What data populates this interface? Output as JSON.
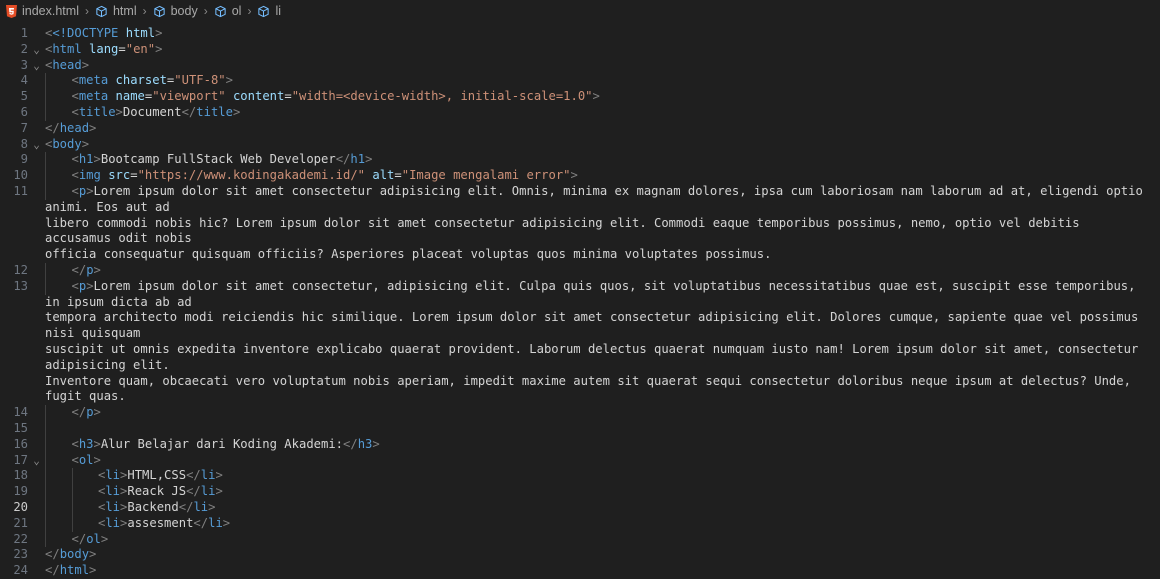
{
  "breadcrumb": {
    "file": "index.html",
    "items": [
      "html",
      "body",
      "ol",
      "li"
    ]
  },
  "editor": {
    "active_line": "20",
    "line_numbers": [
      "1",
      "2",
      "3",
      "4",
      "5",
      "6",
      "7",
      "8",
      "9",
      "10",
      "11",
      "12",
      "13",
      "14",
      "15",
      "16",
      "17",
      "18",
      "19",
      "20",
      "21",
      "22",
      "23",
      "24"
    ],
    "code": {
      "doctype": "<!DOCTYPE",
      "doctype_html": "html",
      "html_open": "html",
      "lang_attr": "lang",
      "lang_val": "\"en\"",
      "head": "head",
      "meta": "meta",
      "charset_attr": "charset",
      "charset_val": "\"UTF-8\"",
      "name_attr": "name",
      "name_val": "\"viewport\"",
      "content_attr": "content",
      "content_val": "\"width=<device-width>, initial-scale=1.0\"",
      "title": "title",
      "title_text": "Document",
      "body": "body",
      "h1": "h1",
      "h1_text": "Bootcamp FullStack Web Developer",
      "img": "img",
      "src_attr": "src",
      "src_val": "\"https://www.kodingakademi.id/\"",
      "alt_attr": "alt",
      "alt_val": "\"Image mengalami error\"",
      "p": "p",
      "p1_line1": "Lorem ipsum dolor sit amet consectetur adipisicing elit. Omnis, minima ex magnam dolores, ipsa cum laboriosam nam laborum ad at, eligendi optio animi. Eos aut ad",
      "p1_line2": "libero commodi nobis hic? Lorem ipsum dolor sit amet consectetur adipisicing elit. Commodi eaque temporibus possimus, nemo, optio vel debitis accusamus odit nobis",
      "p1_line3": "officia consequatur quisquam officiis? Asperiores placeat voluptas quos minima voluptates possimus.",
      "p2_line1": "Lorem ipsum dolor sit amet consectetur, adipisicing elit. Culpa quis quos, sit voluptatibus necessitatibus quae est, suscipit esse temporibus, in ipsum dicta ab ad",
      "p2_line2": "tempora architecto modi reiciendis hic similique. Lorem ipsum dolor sit amet consectetur adipisicing elit. Dolores cumque, sapiente quae vel possimus nisi quisquam",
      "p2_line3": "suscipit ut omnis expedita inventore explicabo quaerat provident. Laborum delectus quaerat numquam iusto nam! Lorem ipsum dolor sit amet, consectetur adipisicing elit.",
      "p2_line4": "Inventore quam, obcaecati vero voluptatum nobis aperiam, impedit maxime autem sit quaerat sequi consectetur doloribus neque ipsum at delectus? Unde, fugit quas.",
      "h3": "h3",
      "h3_text": "Alur Belajar dari Koding Akademi:",
      "ol": "ol",
      "li": "li",
      "li1": "HTML,CSS",
      "li2": "Reack JS",
      "li3": "Backend",
      "li4": "assesment"
    }
  },
  "colors": {
    "background": "#1f1f1f",
    "tag": "#569cd6",
    "attribute": "#9cdcfe",
    "string": "#ce9178",
    "text": "#d4d4d4",
    "punctuation": "#808080",
    "line_number": "#6e7681"
  }
}
